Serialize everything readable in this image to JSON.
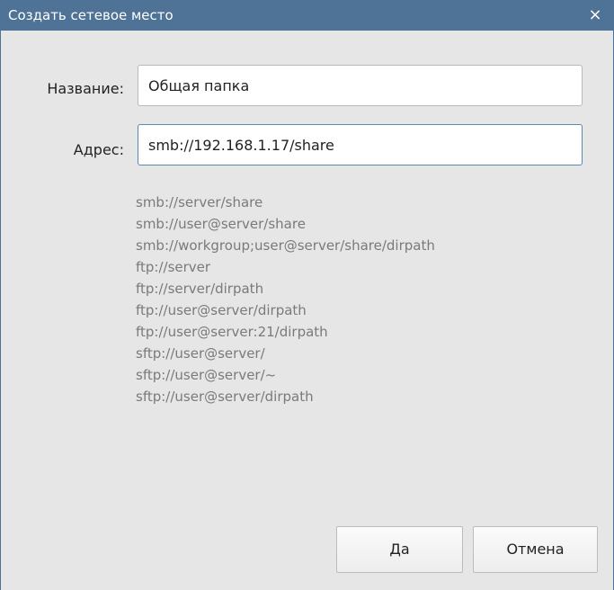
{
  "window": {
    "title": "Создать сетевое место",
    "close_glyph": "×"
  },
  "form": {
    "name_label": "Название:",
    "name_value": "Общая папка",
    "address_label": "Адрес:",
    "address_value": "smb://192.168.1.17/share"
  },
  "examples": [
    "smb://server/share",
    "smb://user@server/share",
    "smb://workgroup;user@server/share/dirpath",
    "ftp://server",
    "ftp://server/dirpath",
    "ftp://user@server/dirpath",
    "ftp://user@server:21/dirpath",
    "sftp://user@server/",
    "sftp://user@server/~",
    "sftp://user@server/dirpath"
  ],
  "buttons": {
    "ok_label": "Да",
    "cancel_label": "Отмена"
  },
  "colors": {
    "titlebar": "#4f7396",
    "background": "#e6e6e6",
    "hint_text": "#7a7a7a"
  }
}
